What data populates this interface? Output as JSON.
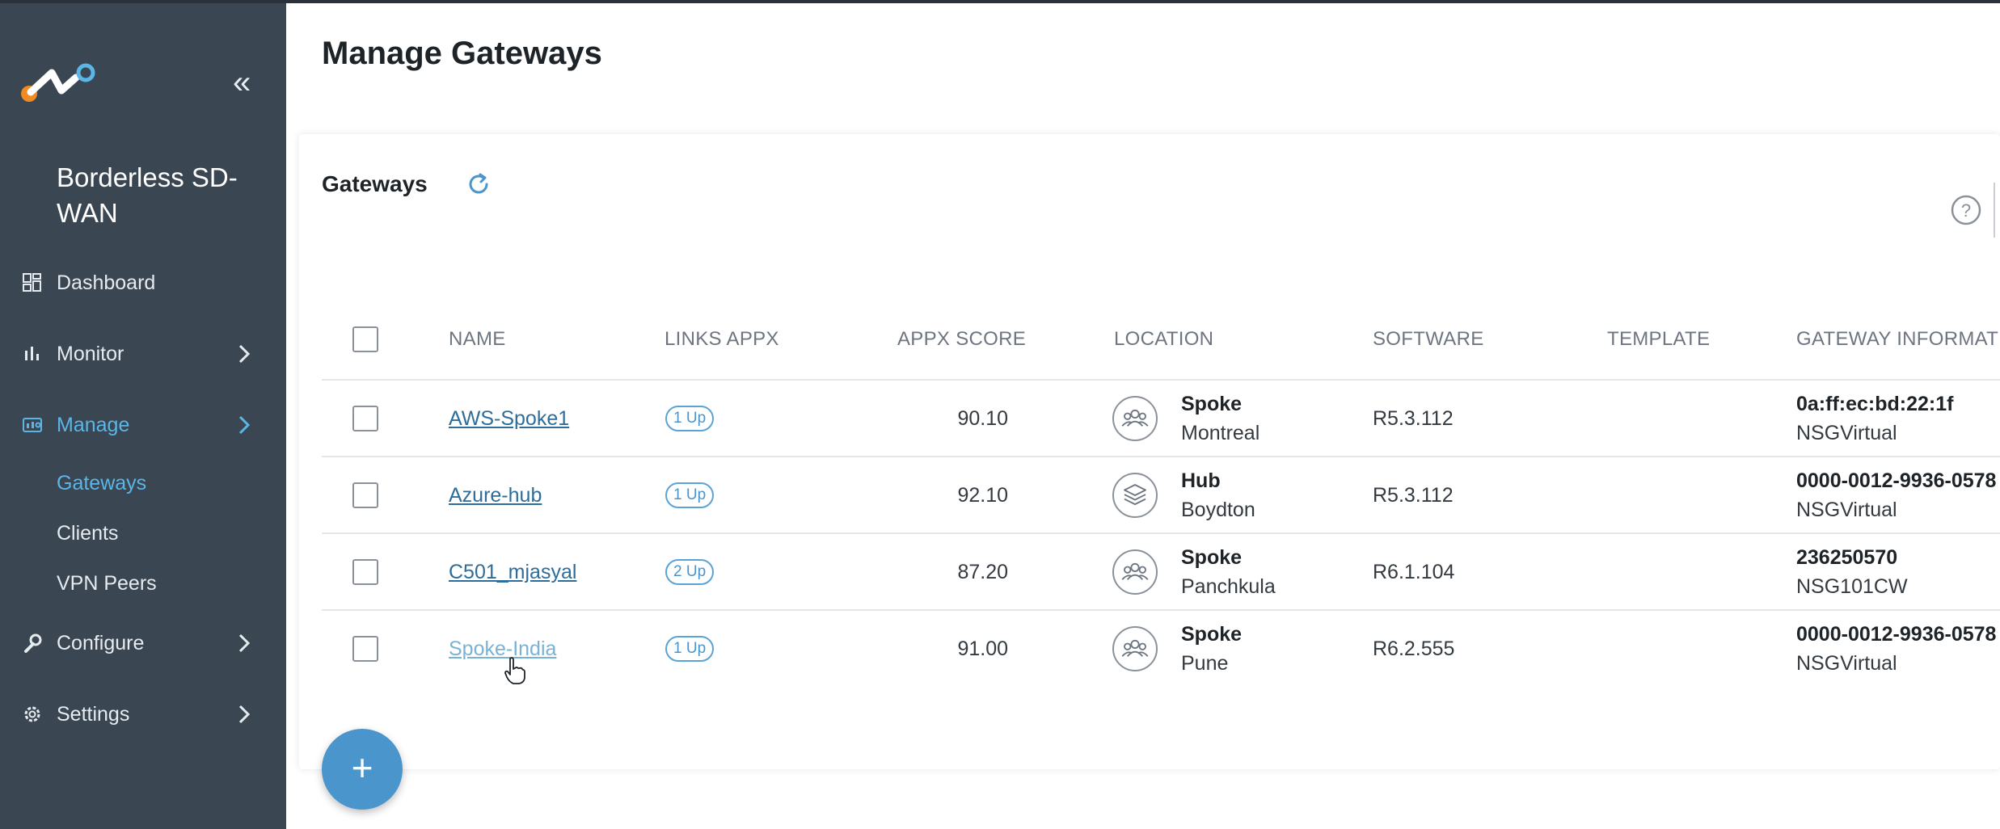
{
  "sidebar": {
    "brand": "Borderless SD-WAN",
    "items": [
      {
        "label": "Dashboard",
        "icon": "dashboard-icon"
      },
      {
        "label": "Monitor",
        "icon": "bar-chart-icon"
      },
      {
        "label": "Manage",
        "icon": "manage-icon"
      },
      {
        "label": "Configure",
        "icon": "wrench-icon"
      },
      {
        "label": "Settings",
        "icon": "gear-icon"
      }
    ],
    "manage_sub": [
      "Gateways",
      "Clients",
      "VPN Peers"
    ],
    "active_color": "#5bb6e8"
  },
  "page": {
    "title": "Manage Gateways"
  },
  "card": {
    "title": "Gateways"
  },
  "table": {
    "columns": [
      "NAME",
      "LINKS APPX",
      "APPX SCORE",
      "LOCATION",
      "SOFTWARE",
      "TEMPLATE",
      "GATEWAY INFORMAT"
    ],
    "rows": [
      {
        "name": "AWS-Spoke1",
        "links": "1 Up",
        "score": "90.10",
        "loc_icon": "group-icon",
        "loc_type": "Spoke",
        "loc_city": "Montreal",
        "software": "R5.3.112",
        "template": "",
        "gw_id": "0a:ff:ec:bd:22:1f",
        "gw_model": "NSGVirtual"
      },
      {
        "name": "Azure-hub",
        "links": "1 Up",
        "score": "92.10",
        "loc_icon": "layers-icon",
        "loc_type": "Hub",
        "loc_city": "Boydton",
        "software": "R5.3.112",
        "template": "",
        "gw_id": "0000-0012-9936-0578",
        "gw_model": "NSGVirtual"
      },
      {
        "name": "C501_mjasyal",
        "links": "2 Up",
        "score": "87.20",
        "loc_icon": "group-icon",
        "loc_type": "Spoke",
        "loc_city": "Panchkula",
        "software": "R6.1.104",
        "template": "",
        "gw_id": "236250570",
        "gw_model": "NSG101CW"
      },
      {
        "name": "Spoke-India",
        "links": "1 Up",
        "score": "91.00",
        "loc_icon": "group-icon",
        "loc_type": "Spoke",
        "loc_city": "Pune",
        "software": "R6.2.555",
        "template": "",
        "gw_id": "0000-0012-9936-0578",
        "gw_model": "NSGVirtual"
      }
    ]
  },
  "fab": {
    "label": "+"
  }
}
